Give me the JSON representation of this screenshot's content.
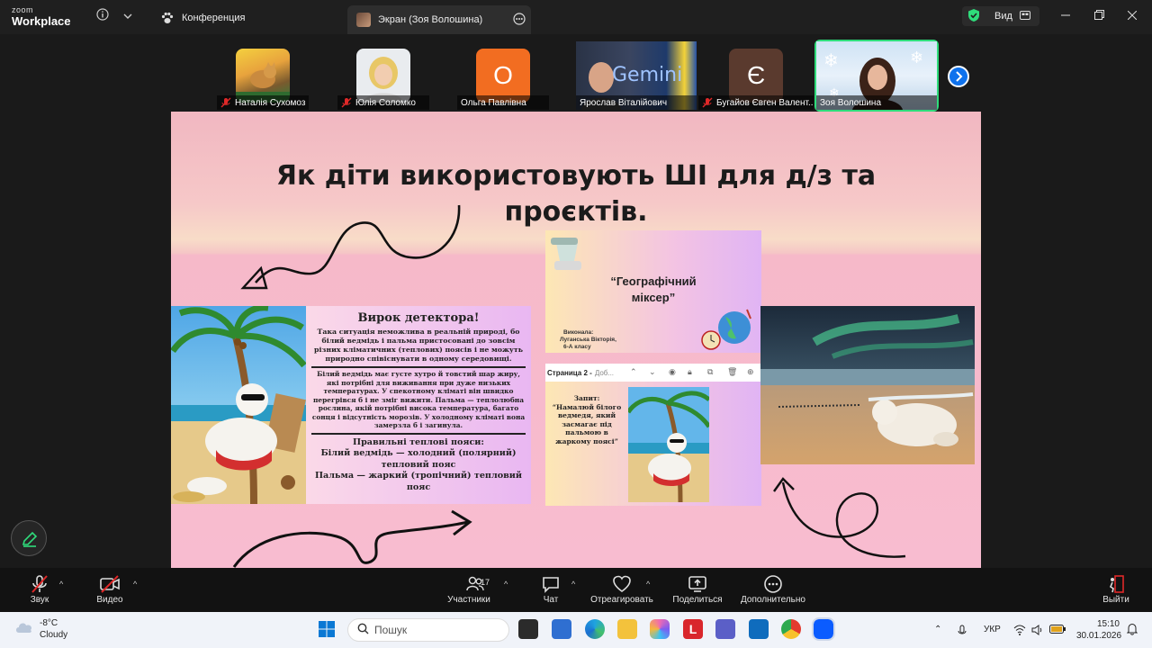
{
  "app": {
    "logo_line1": "zoom",
    "logo_line2": "Workplace"
  },
  "tabs": [
    {
      "label": "Конференция"
    },
    {
      "label": "Экран (Зоя Волошина)"
    }
  ],
  "view_button": {
    "label": "Вид"
  },
  "participants": [
    {
      "name": "Наталія Сухомоз",
      "muted": true
    },
    {
      "name": "Юлія Соломко",
      "muted": true
    },
    {
      "name": "Ольга Павлівна",
      "muted": false,
      "initial": "О",
      "color": "#f26d21"
    },
    {
      "name": "Ярослав Віталійович",
      "muted": false
    },
    {
      "name": "Бугайов Євген Валент...",
      "muted": true,
      "initial": "Є",
      "color": "#5a3a2e"
    },
    {
      "name": "Зоя Волошина",
      "muted": false
    }
  ],
  "slide": {
    "title": "Як діти використовують ШІ для д/з та проєктів.",
    "verdict": {
      "heading": "Вирок детектора!",
      "paragraph1": "Така ситуація неможлива в реальній природі, бо білий ведмідь і пальма пристосовані до зовсім різних кліматичних (теплових) поясів і не можуть природно співіснувати в одному середовищі.",
      "paragraph2": "Білий ведмідь має густе хутро й товстий шар жиру, які потрібні для виживання при дуже низьких температурах. У спекотному кліматі він швидко перегрівся б і не зміг вижити. Пальма — теплолюбна рослина, якій потрібні висока температура, багато сонця і відсутність морозів. У холодному кліматі вона замерзла б і загинула.",
      "zones_heading": "Правильні теплові пояси:",
      "zone_bear": "Білий ведмідь — холодний (полярний) тепловий пояс",
      "zone_palm": "Пальма — жаркий (тропічний) тепловий пояс"
    },
    "project": {
      "title": "“Географічний міксер”",
      "author_line1": "Виконала:",
      "author_line2": "Луганська Вікторія,",
      "author_line3": "6-А класу",
      "page_label": "Страница 2 -",
      "page_placeholder": "Доб...",
      "query_heading": "Запит:",
      "query_text": "“Намалюй білого ведмедя, який засмагає під пальмою в жаркому поясі”"
    }
  },
  "controls": {
    "audio": "Звук",
    "video": "Видео",
    "participants": "Участники",
    "participants_count": "17",
    "chat": "Чат",
    "react": "Отреагировать",
    "share": "Поделиться",
    "more": "Дополнительно",
    "leave": "Выйти"
  },
  "taskbar": {
    "temperature": "-8°C",
    "weather": "Cloudy",
    "search_placeholder": "Пошук",
    "language": "УКР",
    "time": "15:10",
    "date": "30.01.2026"
  },
  "colors": {
    "accent_green": "#2fdc7b",
    "zoom_blue": "#0e72ed",
    "slide_pink": "#f8bcd0"
  }
}
